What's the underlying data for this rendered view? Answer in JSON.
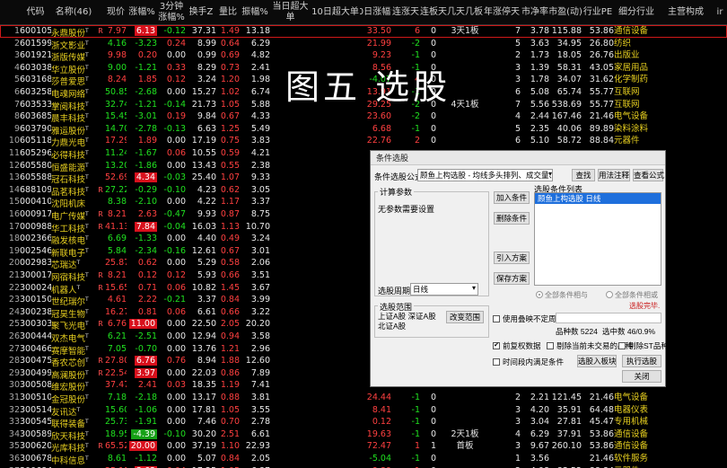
{
  "headers": [
    "",
    "代码",
    "名称(46)",
    "",
    "现价",
    "涨幅%",
    "3分钟涨幅%",
    "换手Z",
    "量比",
    "振幅%",
    "当日超大单",
    "10日超大单",
    "20日涨幅%",
    "连涨天",
    "连板天",
    "几天几板",
    "年涨停天",
    "市净率",
    "市盈(动)",
    "行业PE",
    "细分行业",
    "主营构成",
    "ir"
  ],
  "rows": [
    [
      "1",
      "600105",
      "永鼎股份",
      "T",
      "R",
      "7.97",
      "6.13",
      "-0.12",
      "37.31",
      "1.49",
      "13.18",
      "",
      "",
      "33.50",
      "6",
      "0",
      "3天1板",
      "7",
      "3.78",
      "115.88",
      "53.86",
      "通信设备"
    ],
    [
      "2",
      "601599",
      "浙文影业",
      "T",
      "",
      "4.16",
      "-3.23",
      "0.24",
      "8.99",
      "0.64",
      "6.29",
      "",
      "",
      "21.99",
      "-2",
      "0",
      "",
      "5",
      "3.63",
      "34.95",
      "26.80",
      "纺织"
    ],
    [
      "3",
      "601921",
      "浙版传媒",
      "T",
      "",
      "9.98",
      "0.20",
      "0.00",
      "0.99",
      "0.69",
      "4.82",
      "",
      "",
      "9.23",
      "-1",
      "0",
      "",
      "2",
      "1.73",
      "18.05",
      "26.76",
      "出版业"
    ],
    [
      "4",
      "603038",
      "华立股份",
      "T",
      "",
      "9.00",
      "-1.21",
      "0.33",
      "8.29",
      "0.73",
      "2.41",
      "",
      "",
      "8.56",
      "-1",
      "0",
      "",
      "3",
      "1.39",
      "58.31",
      "43.05",
      "家居用品"
    ],
    [
      "5",
      "603168",
      "莎普爱思",
      "T",
      "",
      "8.24",
      "1.85",
      "0.12",
      "3.24",
      "1.20",
      "1.98",
      "",
      "",
      "-4.07",
      "4",
      "0",
      "",
      "3",
      "1.78",
      "34.07",
      "31.62",
      "化学制药"
    ],
    [
      "6",
      "603258",
      "电魂网络",
      "T",
      "",
      "50.85",
      "-2.68",
      "0.00",
      "15.27",
      "1.02",
      "6.74",
      "",
      "",
      "13.91",
      "-1",
      "0",
      "",
      "6",
      "5.08",
      "65.74",
      "55.77",
      "互联网"
    ],
    [
      "7",
      "603533",
      "掌阅科技",
      "T",
      "",
      "32.74",
      "-1.21",
      "-0.14",
      "21.73",
      "1.05",
      "5.88",
      "",
      "",
      "29.25",
      "-2",
      "0",
      "4天1板",
      "7",
      "5.56",
      "538.69",
      "55.77",
      "互联网"
    ],
    [
      "8",
      "603685",
      "晨丰科技",
      "T",
      "",
      "15.45",
      "-3.01",
      "0.19",
      "9.84",
      "0.67",
      "4.33",
      "",
      "",
      "23.60",
      "-2",
      "0",
      "",
      "4",
      "2.44",
      "167.46",
      "21.46",
      "电气设备"
    ],
    [
      "9",
      "603790",
      "雅运股份",
      "T",
      "",
      "14.70",
      "-2.78",
      "-0.13",
      "6.63",
      "1.25",
      "5.49",
      "",
      "",
      "6.68",
      "-1",
      "0",
      "",
      "5",
      "2.35",
      "40.06",
      "89.89",
      "染料涂料"
    ],
    [
      "10",
      "605118",
      "力鼎光电",
      "T",
      "",
      "17.29",
      "1.89",
      "0.00",
      "17.19",
      "0.75",
      "3.83",
      "",
      "",
      "22.76",
      "2",
      "0",
      "",
      "6",
      "5.10",
      "58.72",
      "88.84",
      "元器件"
    ],
    [
      "11",
      "605296",
      "必得科技",
      "T",
      "",
      "11.24",
      "-1.67",
      "0.06",
      "10.55",
      "0.59",
      "4.21",
      "",
      "",
      "",
      "",
      "",
      "",
      "",
      "",
      "",
      "",
      ""
    ],
    [
      "12",
      "605580",
      "恒盛能源",
      "T",
      "",
      "13.20",
      "-1.86",
      "0.00",
      "13.43",
      "0.55",
      "2.38",
      "",
      "",
      "",
      "",
      "",
      "",
      "",
      "",
      "",
      "",
      ""
    ],
    [
      "13",
      "605588",
      "冠石科技",
      "T",
      "",
      "52.69",
      "4.34",
      "-0.03",
      "25.40",
      "1.07",
      "9.33",
      "",
      "",
      "",
      "",
      "",
      "",
      "",
      "",
      "",
      "",
      ""
    ],
    [
      "14",
      "688109",
      "品茗科技",
      "T",
      "R",
      "27.22",
      "-0.29",
      "-0.10",
      "4.23",
      "0.62",
      "3.05",
      "",
      "",
      "",
      "",
      "",
      "",
      "",
      "",
      "",
      "",
      ""
    ],
    [
      "15",
      "000410",
      "沈阳机床",
      "",
      "",
      "8.38",
      "-2.10",
      "0.00",
      "4.22",
      "1.17",
      "3.37",
      "",
      "",
      "",
      "",
      "",
      "",
      "",
      "",
      "",
      "",
      ""
    ],
    [
      "16",
      "000917",
      "电广传媒",
      "T",
      "R",
      "8.21",
      "2.63",
      "-0.47",
      "9.93",
      "0.87",
      "8.75",
      "",
      "",
      "",
      "",
      "",
      "",
      "",
      "",
      "",
      "",
      ""
    ],
    [
      "17",
      "000988",
      "华工科技",
      "T",
      "R",
      "41.13",
      "7.84",
      "-0.04",
      "16.03",
      "1.13",
      "10.70",
      "",
      "",
      "",
      "",
      "",
      "",
      "",
      "",
      "",
      "",
      ""
    ],
    [
      "18",
      "002366",
      "融发核电",
      "T",
      "",
      "6.69",
      "-1.33",
      "0.00",
      "4.40",
      "0.49",
      "3.24",
      "",
      "",
      "",
      "",
      "",
      "",
      "",
      "",
      "",
      "",
      ""
    ],
    [
      "19",
      "002546",
      "新联电子",
      "T",
      "",
      "5.84",
      "-2.34",
      "-0.16",
      "12.61",
      "0.67",
      "3.01",
      "",
      "",
      "",
      "",
      "",
      "",
      "",
      "",
      "",
      "",
      ""
    ],
    [
      "20",
      "002983",
      "芯瑞达",
      "T",
      "",
      "25.87",
      "0.62",
      "0.00",
      "5.29",
      "0.58",
      "2.06",
      "",
      "",
      "",
      "",
      "",
      "",
      "",
      "",
      "",
      "",
      ""
    ],
    [
      "21",
      "300017",
      "网宿科技",
      "T",
      "R",
      "8.21",
      "0.12",
      "0.12",
      "5.93",
      "0.66",
      "3.51",
      "",
      "",
      "",
      "",
      "",
      "",
      "",
      "",
      "",
      "",
      ""
    ],
    [
      "22",
      "300024",
      "机器人",
      "T",
      "R",
      "15.65",
      "0.71",
      "0.06",
      "10.82",
      "1.45",
      "3.67",
      "",
      "",
      "",
      "",
      "",
      "",
      "",
      "",
      "",
      "",
      ""
    ],
    [
      "23",
      "300150",
      "世纪瑞尔",
      "T",
      "",
      "4.61",
      "2.22",
      "-0.21",
      "3.37",
      "0.84",
      "3.99",
      "",
      "",
      "",
      "",
      "",
      "",
      "",
      "",
      "",
      "",
      ""
    ],
    [
      "24",
      "300238",
      "冠昊生物",
      "T",
      "",
      "16.27",
      "0.81",
      "0.06",
      "6.61",
      "0.66",
      "3.22",
      "",
      "",
      "",
      "",
      "",
      "",
      "",
      "",
      "",
      "",
      ""
    ],
    [
      "25",
      "300303",
      "聚飞光电",
      "T",
      "R",
      "6.76",
      "11.00",
      "0.00",
      "22.50",
      "2.05",
      "20.20",
      "",
      "",
      "",
      "",
      "",
      "",
      "",
      "",
      "",
      "",
      ""
    ],
    [
      "26",
      "300444",
      "双杰电气",
      "T",
      "",
      "6.21",
      "-2.51",
      "0.00",
      "12.94",
      "0.94",
      "3.58",
      "",
      "",
      "",
      "",
      "",
      "",
      "",
      "",
      "",
      "",
      ""
    ],
    [
      "27",
      "300466",
      "赛摩智能",
      "T",
      "",
      "7.05",
      "-0.70",
      "0.00",
      "13.76",
      "1.21",
      "2.96",
      "",
      "",
      "",
      "",
      "",
      "",
      "",
      "",
      "",
      "",
      ""
    ],
    [
      "28",
      "300475",
      "香农芯创",
      "T",
      "R",
      "27.80",
      "6.76",
      "0.76",
      "8.94",
      "1.88",
      "12.60",
      "",
      "",
      "",
      "",
      "",
      "",
      "",
      "",
      "",
      "",
      ""
    ],
    [
      "29",
      "300499",
      "高澜股份",
      "T",
      "R",
      "22.54",
      "3.97",
      "0.00",
      "22.03",
      "0.86",
      "7.89",
      "",
      "",
      "",
      "",
      "",
      "",
      "",
      "",
      "",
      "",
      ""
    ],
    [
      "30",
      "300508",
      "维宏股份",
      "T",
      "",
      "37.47",
      "2.41",
      "0.03",
      "18.35",
      "1.19",
      "7.41",
      "",
      "",
      "",
      "",
      "",
      "",
      "",
      "",
      "",
      "",
      ""
    ],
    [
      "31",
      "300510",
      "金冠股份",
      "T",
      "",
      "7.18",
      "-2.18",
      "0.00",
      "13.17",
      "0.88",
      "3.81",
      "",
      "",
      "24.44",
      "-1",
      "0",
      "",
      "2",
      "2.21",
      "121.45",
      "21.46",
      "电气设备"
    ],
    [
      "32",
      "300514",
      "友讯达",
      "T",
      "",
      "15.60",
      "-1.06",
      "0.00",
      "17.81",
      "1.05",
      "3.55",
      "",
      "",
      "8.41",
      "-1",
      "0",
      "",
      "3",
      "4.20",
      "35.91",
      "64.48",
      "电器仪表"
    ],
    [
      "33",
      "300545",
      "联得装备",
      "T",
      "",
      "25.73",
      "-1.91",
      "0.00",
      "7.46",
      "0.70",
      "2.78",
      "",
      "",
      "0.12",
      "-1",
      "0",
      "",
      "3",
      "3.04",
      "27.81",
      "45.47",
      "专用机械"
    ],
    [
      "34",
      "300589",
      "欣天科技",
      "T",
      "",
      "18.95",
      "-4.39",
      "-0.10",
      "30.20",
      "2.51",
      "6.61",
      "",
      "",
      "19.63",
      "-1",
      "0",
      "2天1板",
      "4",
      "6.29",
      "37.91",
      "53.86",
      "通信设备"
    ],
    [
      "35",
      "300620",
      "光库科技",
      "T",
      "R",
      "65.52",
      "20.00",
      "0.00",
      "37.19",
      "1.10",
      "22.93",
      "",
      "",
      "72.47",
      "1",
      "1",
      "首板",
      "3",
      "9.67",
      "260.10",
      "53.86",
      "通信设备"
    ],
    [
      "36",
      "300678",
      "中科信息",
      "T",
      "",
      "8.61",
      "-1.12",
      "0.00",
      "5.07",
      "0.84",
      "2.05",
      "",
      "",
      "-5.04",
      "-1",
      "0",
      "",
      "1",
      "3.56",
      "",
      "21.46",
      "软件服务"
    ],
    [
      "37",
      "300684",
      "中石科技",
      "T",
      "",
      "25.11",
      "3.63",
      "0.04",
      "17.25",
      "1.05",
      "6.87",
      "",
      "",
      "9.89",
      "1",
      "0",
      "",
      "2",
      "4.08",
      "83.52",
      "88.84",
      "元器件"
    ]
  ],
  "overlay_text": "图五 选股",
  "dialog": {
    "title": "条件选股",
    "formula_label": "条件选股公式",
    "formula_value": "顾鱼上构选股 - 均线多头排列、成交量、涨跌幅",
    "find_btn": "查找",
    "usage_btn": "用法注释",
    "view_btn": "查看公式",
    "calc_params": "计算参数",
    "no_params": "无参数需要设置",
    "list_label": "选股条件列表",
    "list_items": [
      "顾鱼上构选股 日线"
    ],
    "add_btn": "加入条件",
    "del_btn": "删除条件",
    "load_btn": "引入方案",
    "save_btn": "保存方案",
    "period_label": "选股周期:",
    "period_value": "日线",
    "all_and": "全部条件相与",
    "all_or": "全部条件相或",
    "done_text": "选股完毕.",
    "range_label": "选股范围",
    "range_value": "上证A股 深证A股 北证A股",
    "change_range_btn": "改变范围",
    "use_period": "使用叠映不定周期",
    "total_label": "品种数",
    "total_value": "5224",
    "selected_label": "选中数",
    "selected_value": "46/0.9%",
    "fq_label": "前复权数据",
    "rm_untrade": "剔除当前未交易的品种",
    "rm_st": "剔除ST品种",
    "time_cond": "时间段内满足条件",
    "to_board_btn": "选股入板块",
    "run_btn": "执行选股",
    "close_btn": "关闭"
  }
}
